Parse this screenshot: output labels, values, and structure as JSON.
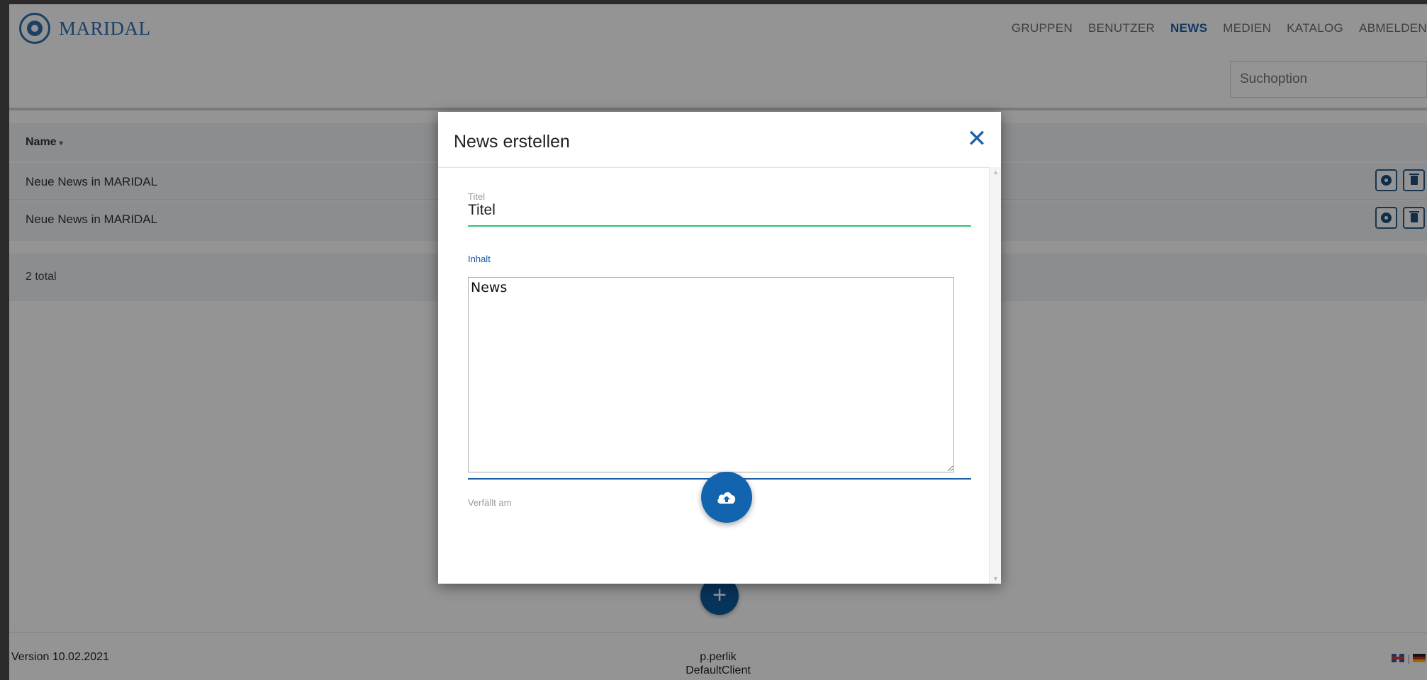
{
  "brand": {
    "name": "MARIDAL"
  },
  "nav": {
    "items": [
      {
        "label": "GRUPPEN"
      },
      {
        "label": "BENUTZER"
      },
      {
        "label": "NEWS"
      },
      {
        "label": "MEDIEN"
      },
      {
        "label": "KATALOG"
      },
      {
        "label": "ABMELDEN"
      }
    ],
    "active": "NEWS"
  },
  "search": {
    "placeholder": "Suchoption"
  },
  "table": {
    "column_header": "Name",
    "sort_indicator": "▾",
    "rows": [
      {
        "name": "Neue News in MARIDAL"
      },
      {
        "name": "Neue News in MARIDAL"
      }
    ],
    "total_label": "2 total"
  },
  "footer": {
    "version": "Version 10.02.2021",
    "user": "p.perlik",
    "client": "DefaultClient",
    "language_separator": "|"
  },
  "modal": {
    "title": "News erstellen",
    "close_symbol": "✕",
    "titel_label": "Titel",
    "titel_value": "Titel",
    "inhalt_label": "Inhalt",
    "inhalt_value": "News",
    "expires_label": "Verfällt am"
  },
  "colors": {
    "accent": "#1b5fa8",
    "fab": "#1164ad",
    "success_underline": "#2ec36a",
    "overlay": "rgba(0,0,0,0.42)"
  },
  "icons": {
    "logo": "maridal-logo-icon",
    "row_action_1": "steering-wheel-icon",
    "row_action_2": "trash-icon",
    "add": "plus-icon",
    "upload": "cloud-upload-icon",
    "close": "close-icon"
  }
}
